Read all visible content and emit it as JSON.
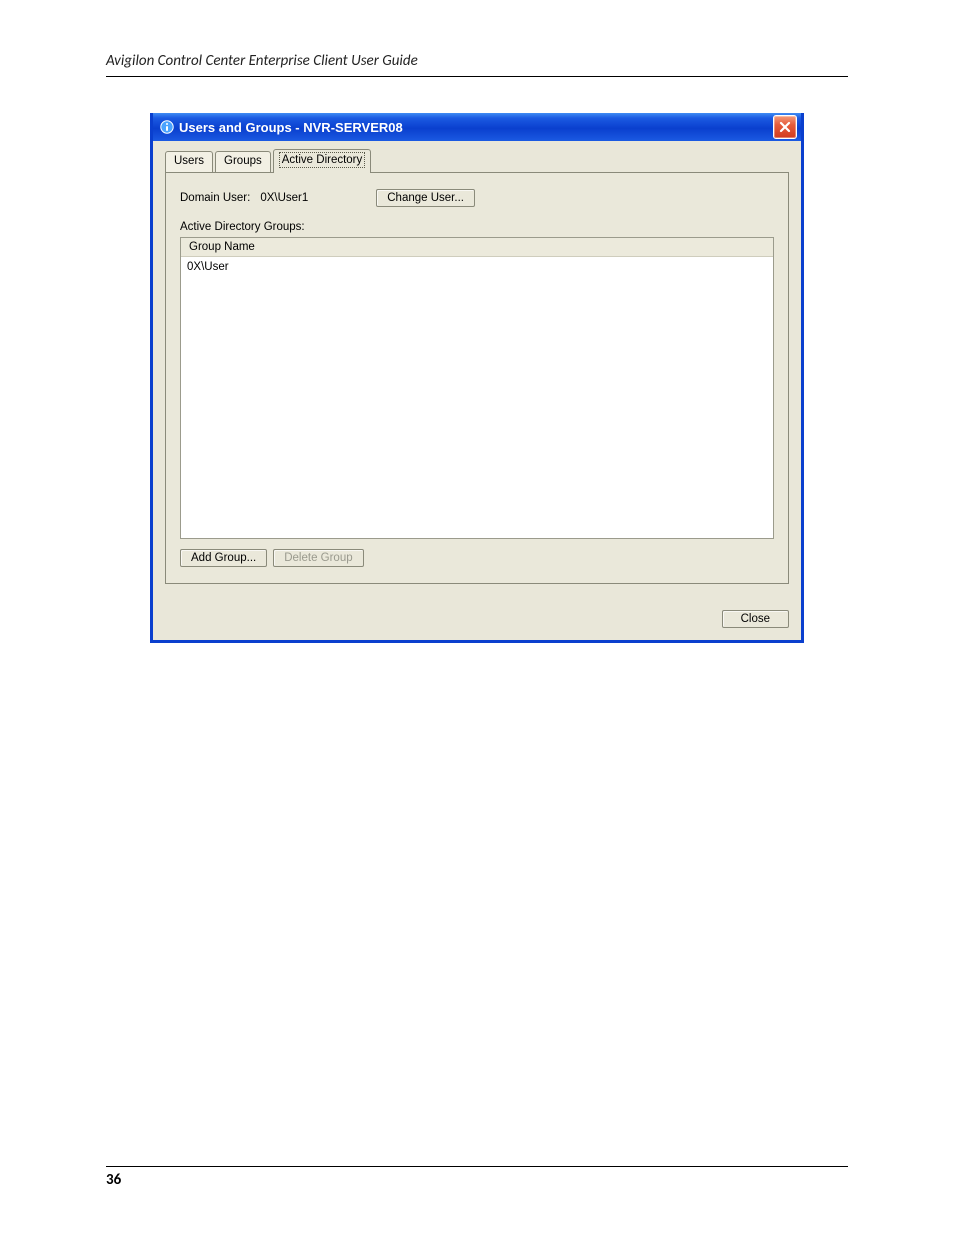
{
  "doc": {
    "header_title": "Avigilon Control Center Enterprise Client User Guide",
    "page_number": "36"
  },
  "window": {
    "title": "Users and Groups - NVR-SERVER08",
    "close_icon_name": "close-icon",
    "app_icon_name": "app-icon"
  },
  "tabs": {
    "items": [
      {
        "label": "Users",
        "active": false
      },
      {
        "label": "Groups",
        "active": false
      },
      {
        "label": "Active Directory",
        "active": true
      }
    ]
  },
  "panel": {
    "domain_user_label": "Domain User:",
    "domain_user_value": "0X\\User1",
    "change_user_button": "Change User...",
    "groups_label": "Active Directory Groups:",
    "listview": {
      "column_header": "Group Name",
      "rows": [
        "0X\\User"
      ]
    },
    "buttons": {
      "add_group": "Add Group...",
      "delete_group": "Delete Group",
      "delete_group_enabled": false
    }
  },
  "footer": {
    "close_button": "Close"
  }
}
